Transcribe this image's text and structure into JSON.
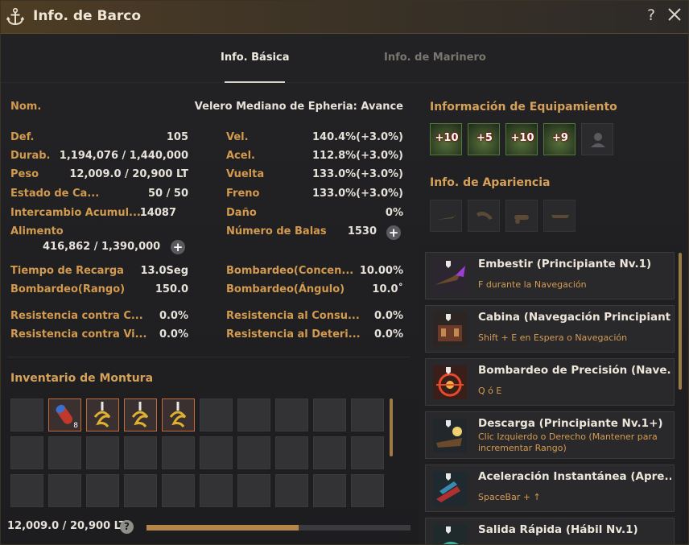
{
  "window": {
    "title": "Info. de Barco",
    "help": "?"
  },
  "tabs": [
    {
      "label": "Info. Básica",
      "active": true
    },
    {
      "label": "Info. de Marinero",
      "active": false
    }
  ],
  "ship": {
    "name_label": "Nom.",
    "name": "Velero Mediano de Epheria: Avance"
  },
  "stats_left": [
    {
      "label": "Def.",
      "value": "105"
    },
    {
      "label": "Durab.",
      "value": "1,194,076 / 1,440,000"
    },
    {
      "label": "Peso",
      "value": "12,009.0 / 20,900 LT"
    },
    {
      "label": "Estado de Ca...",
      "value": "50 / 50"
    },
    {
      "label": "Intercambio Acumul...",
      "value": "14087"
    }
  ],
  "food": {
    "label": "Alimento",
    "value": "416,862 / 1,390,000"
  },
  "stats_right": [
    {
      "label": "Vel.",
      "value": "140.4%(+3.0%)"
    },
    {
      "label": "Acel.",
      "value": "112.8%(+3.0%)"
    },
    {
      "label": "Vuelta",
      "value": "133.0%(+3.0%)"
    },
    {
      "label": "Freno",
      "value": "133.0%(+3.0%)"
    },
    {
      "label": "Daño",
      "value": "0%"
    }
  ],
  "cannonballs": {
    "label": "Número de Balas",
    "value": "1530"
  },
  "combat_left": [
    {
      "label": "Tiempo de Recarga",
      "value": "13.0Seg"
    },
    {
      "label": "Bombardeo(Rango)",
      "value": "150.0"
    }
  ],
  "combat_right": [
    {
      "label": "Bombardeo(Concen...",
      "value": "10.00%"
    },
    {
      "label": "Bombardeo(Ángulo)",
      "value": "10.0˚"
    }
  ],
  "resist_left": [
    {
      "label": "Resistencia contra C...",
      "value": "0.0%"
    },
    {
      "label": "Resistencia contra Vi...",
      "value": "0.0%"
    }
  ],
  "resist_right": [
    {
      "label": "Resistencia al Consu...",
      "value": "0.0%"
    },
    {
      "label": "Resistencia al Deteri...",
      "value": "0.0%"
    }
  ],
  "equipment": {
    "title": "Información de Equipamiento",
    "items": [
      "+10",
      "+5",
      "+10",
      "+9"
    ]
  },
  "appearance": {
    "title": "Info. de Apariencia"
  },
  "inventory": {
    "title": "Inventario de Montura",
    "first_item_count": "8"
  },
  "weight": {
    "text": "12,009.0 / 20,900 LT",
    "help": "?",
    "fill_fraction": 0.575
  },
  "skills": [
    {
      "name": "Embestir (Principiante Nv.1)",
      "key": "F durante la Navegación"
    },
    {
      "name": "Cabina (Navegación Principiant...",
      "key": "Shift + E en Espera o Navegación"
    },
    {
      "name": "Bombardeo de Precisión (Nave...",
      "key": "Q ó E"
    },
    {
      "name": "Descarga (Principiante Nv.1+)",
      "key": "Clic Izquierdo o Derecho (Mantener para incrementar Rango)"
    },
    {
      "name": "Aceleración Instantánea (Apre...",
      "key": "SpaceBar + ↑"
    },
    {
      "name": "Salida Rápida (Hábil Nv.1)",
      "key": ""
    }
  ],
  "colors": {
    "accent": "#d29a4e",
    "bar_fill": "#b4864a",
    "frame_green": "#4e7a3a"
  }
}
